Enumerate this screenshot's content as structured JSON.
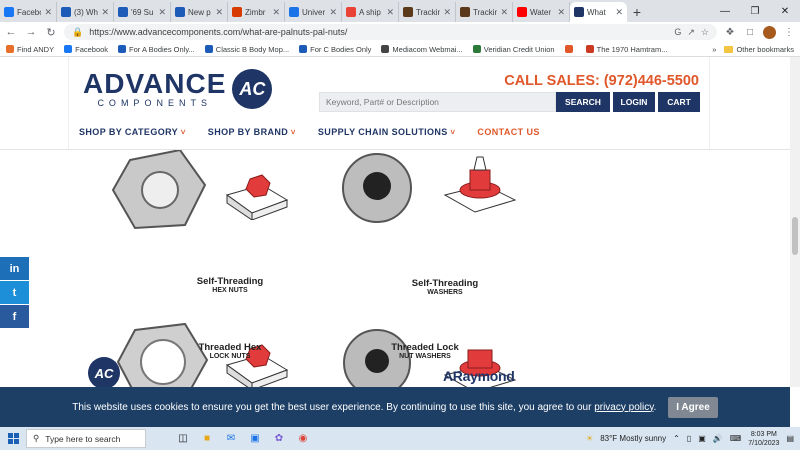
{
  "browser": {
    "tabs": [
      {
        "title": "Facebo",
        "icon": "facebook-icon",
        "color": "#1877f2"
      },
      {
        "title": "(3) Wh",
        "icon": "m-icon",
        "color": "#1c5bb8"
      },
      {
        "title": "'69 Su",
        "icon": "m-icon",
        "color": "#1c5bb8"
      },
      {
        "title": "New p",
        "icon": "m-icon",
        "color": "#1c5bb8"
      },
      {
        "title": "Zimbr",
        "icon": "zimbra-icon",
        "color": "#d83b01"
      },
      {
        "title": "Univer",
        "icon": "globe-icon",
        "color": "#1a73e8"
      },
      {
        "title": "A ship",
        "icon": "gmail-icon",
        "color": "#ea4335"
      },
      {
        "title": "Trackin",
        "icon": "ups-icon",
        "color": "#5a3a1b"
      },
      {
        "title": "Trackin",
        "icon": "ups-icon",
        "color": "#5a3a1b"
      },
      {
        "title": "Water",
        "icon": "youtube-icon",
        "color": "#ff0000"
      },
      {
        "title": "What",
        "icon": "ac-icon",
        "color": "#1f3566",
        "active": true
      }
    ],
    "new_tab": "+",
    "url": "https://www.advancecomponents.com/what-are-palnuts-pal-nuts/",
    "bookmarks": [
      {
        "label": "Find ANDY",
        "color": "#e76f2b"
      },
      {
        "label": "Facebook",
        "color": "#1877f2"
      },
      {
        "label": "For A Bodies Only...",
        "color": "#1c5bb8"
      },
      {
        "label": "Classic B Body Mop...",
        "color": "#1c5bb8"
      },
      {
        "label": "For C Bodies Only",
        "color": "#1c5bb8"
      },
      {
        "label": "Mediacom Webmai...",
        "color": "#444444"
      },
      {
        "label": "Veridian Credit Union",
        "color": "#2b7a3a"
      },
      {
        "label": "",
        "color": "#e0572a"
      },
      {
        "label": "The 1970 Hamtram...",
        "color": "#cc3a22"
      }
    ],
    "other_bookmarks": "Other bookmarks"
  },
  "site": {
    "logo_word": "ADVANCE",
    "logo_sub": "COMPONENTS",
    "logo_mark": "AC",
    "call_sales": "CALL SALES: (972)446-5500",
    "search_placeholder": "Keyword, Part# or Description",
    "search_button": "SEARCH",
    "login_button": "LOGIN",
    "cart_button": "CART",
    "menu": [
      {
        "label": "SHOP BY CATEGORY",
        "dropdown": true
      },
      {
        "label": "SHOP BY BRAND",
        "dropdown": true
      },
      {
        "label": "SUPPLY CHAIN SOLUTIONS",
        "dropdown": true
      },
      {
        "label": "CONTACT US",
        "dropdown": false
      }
    ]
  },
  "products": [
    {
      "line1": "Self-Threading",
      "line2": "HEX NUTS"
    },
    {
      "line1": "Self-Threading",
      "line2": "WASHERS"
    },
    {
      "line1": "Threaded Hex",
      "line2": "LOCK NUTS"
    },
    {
      "line1": "Threaded Lock",
      "line2": "NUT WASHERS"
    }
  ],
  "brand_text": "ARaymond",
  "social": [
    "in",
    "t",
    "f"
  ],
  "cookie": {
    "text": "This website uses cookies to ensure you get the best user experience. By continuing to use this site, you agree to our",
    "link": "privacy policy",
    "period": ".",
    "button": "I Agree"
  },
  "taskbar": {
    "search_placeholder": "Type here to search",
    "weather": "83°F  Mostly sunny",
    "time": "8:03 PM",
    "date": "7/10/2023"
  }
}
